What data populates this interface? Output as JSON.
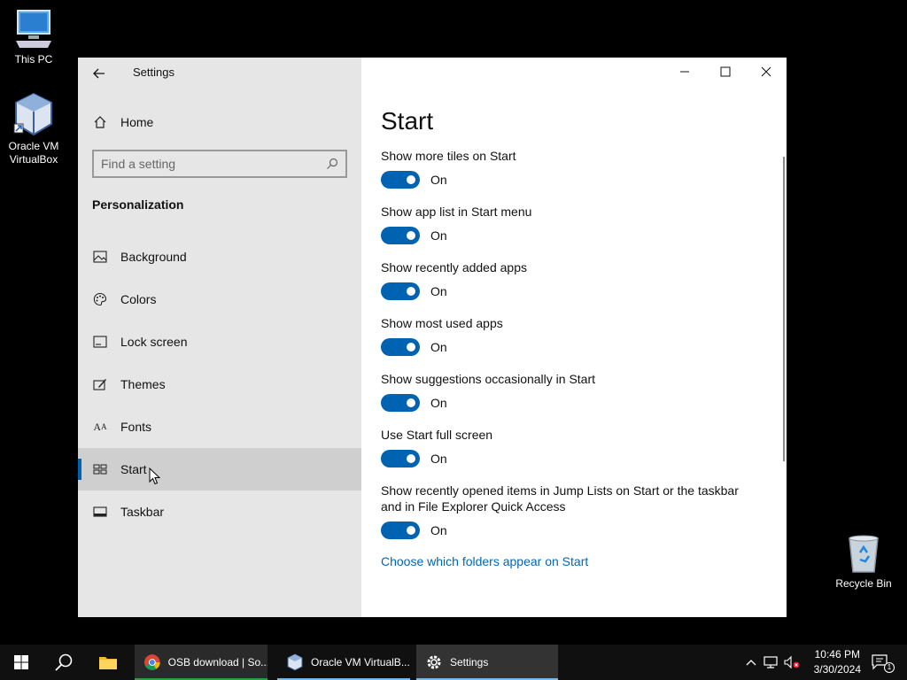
{
  "desktop": {
    "this_pc": "This PC",
    "vbox_line1": "Oracle VM",
    "vbox_line2": "VirtualBox",
    "recycle_bin": "Recycle Bin"
  },
  "window": {
    "title": "Settings",
    "sidebar": {
      "home_label": "Home",
      "search_placeholder": "Find a setting",
      "section_title": "Personalization",
      "items": [
        {
          "label": "Background",
          "icon": "background-icon"
        },
        {
          "label": "Colors",
          "icon": "palette-icon"
        },
        {
          "label": "Lock screen",
          "icon": "lock-screen-icon"
        },
        {
          "label": "Themes",
          "icon": "themes-icon"
        },
        {
          "label": "Fonts",
          "icon": "fonts-icon"
        },
        {
          "label": "Start",
          "icon": "start-icon",
          "active": true
        },
        {
          "label": "Taskbar",
          "icon": "taskbar-icon"
        }
      ]
    },
    "content": {
      "title": "Start",
      "settings": [
        {
          "label": "Show more tiles on Start",
          "state": "On"
        },
        {
          "label": "Show app list in Start menu",
          "state": "On"
        },
        {
          "label": "Show recently added apps",
          "state": "On"
        },
        {
          "label": "Show most used apps",
          "state": "On"
        },
        {
          "label": "Show suggestions occasionally in Start",
          "state": "On"
        },
        {
          "label": "Use Start full screen",
          "state": "On"
        },
        {
          "label": "Show recently opened items in Jump Lists on Start or the taskbar and in File Explorer Quick Access",
          "state": "On"
        }
      ],
      "link": "Choose which folders appear on Start"
    },
    "accent_color": "#0063b1"
  },
  "taskbar": {
    "apps": [
      {
        "label": "OSB download | So..."
      },
      {
        "label": "Oracle VM VirtualB..."
      },
      {
        "label": "Settings"
      }
    ],
    "time": "10:46 PM",
    "date": "3/30/2024",
    "notification_count": "1"
  }
}
